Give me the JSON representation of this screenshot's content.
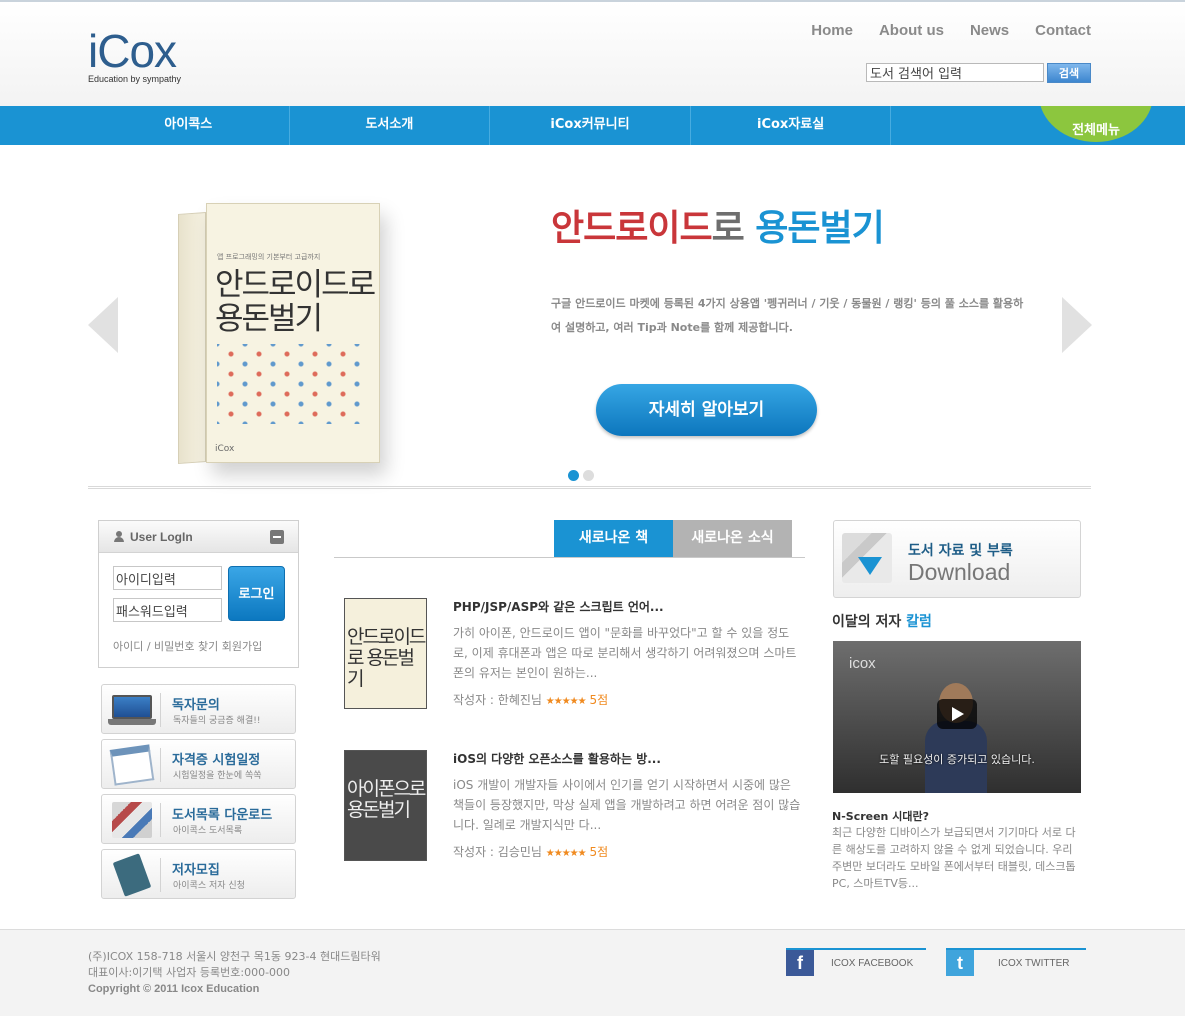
{
  "logo": {
    "text": "iCox",
    "tagline": "Education by sympathy"
  },
  "topnav": [
    "Home",
    "About us",
    "News",
    "Contact"
  ],
  "search": {
    "value": "도서 검색어 입력",
    "button": "검색"
  },
  "gnb": [
    "아이콕스",
    "도서소개",
    "iCox커뮤니티",
    "iCox자료실"
  ],
  "gnb_all": "전체메뉴",
  "hero": {
    "book_title": "안드로이드로 용돈벌기",
    "book_sub": "앱 프로그래밍의 기본부터 고급까지",
    "book_pub": "iCox",
    "title_red": "안드로이드",
    "title_gray": "로 ",
    "title_blue": "용돈벌기",
    "desc": "구글 안드로이드 마켓에 등록된 4가지 상용앱 '펭귀러너 / 기웃 / 동물원 / 랭킹' 등의 풀 소스를 활용하여 설명하고, 여러 Tip과 Note를 함께 제공합니다.",
    "button": "자세히 알아보기",
    "slides": 2,
    "active_slide": 1
  },
  "login": {
    "title": "User LogIn",
    "id_value": "아이디입력",
    "pw_value": "패스워드입력",
    "button": "로그인",
    "links": "아이디 / 비밀번호 찾기  회원가입"
  },
  "quick": [
    {
      "title": "독자문의",
      "sub": "독자들의 궁금증 해결!!"
    },
    {
      "title": "자격증 시험일정",
      "sub": "시험일정을 한눈에 쏙쏙"
    },
    {
      "title": "도서목록 다운로드",
      "sub": "아이콕스 도서목록"
    },
    {
      "title": "저자모집",
      "sub": "아이콕스 저자 신청"
    }
  ],
  "tabs": {
    "active": "새로나온 책",
    "inactive": "새로나온 소식"
  },
  "articles": [
    {
      "cover": "안드로이드로 용돈벌기",
      "title": "PHP/JSP/ASP와 같은 스크립트 언어...",
      "desc": "가히 아이폰, 안드로이드 앱이 \"문화를 바꾸었다\"고 할 수 있을 정도로, 이제 휴대폰과 앱은 따로 분리해서 생각하기 어려워졌으며 스마트폰의 유저는 본인이 원하는...",
      "author": "작성자 : 한혜진님",
      "stars": "★★★★★",
      "score": "5점"
    },
    {
      "cover": "아이폰으로 용돈벌기",
      "title": "iOS의 다양한 오픈소스를 활용하는 방...",
      "desc": "iOS 개발이 개발자들 사이에서 인기를 얻기 시작하면서 시중에 많은 책들이 등장했지만, 막상 실제 앱을 개발하려고 하면 어려운 점이 많습니다. 일례로 개발지식만 다...",
      "author": "작성자 : 김승민님",
      "stars": "★★★★★",
      "score": "5점"
    }
  ],
  "download": {
    "title": "도서 자료 및 부록",
    "sub": "Download"
  },
  "author": {
    "title": "이달의 저자 ",
    "highlight": "칼럼"
  },
  "video": {
    "logo": "icox",
    "subtitle": "도할 필요성이 증가되고 있습니다."
  },
  "column": {
    "title": "N-Screen 시대란?",
    "desc": "최근 다양한 디바이스가 보급되면서 기기마다 서로 다른 해상도를 고려하지 않을 수 없게 되었습니다. 우리 주변만 보더라도 모바일 폰에서부터 태블릿, 데스크톱PC, 스마트TV등..."
  },
  "footer": {
    "address": "(주)ICOX 158-718 서울시 양천구 목1동 923-4 현대드림타워",
    "ceo": "대표이사:이기택 사업자 등록번호:000-000",
    "copyright": "Copyright © 2011 Icox Education",
    "facebook": "ICOX FACEBOOK",
    "twitter": "ICOX TWITTER"
  },
  "colors": {
    "primary": "#1a93d3",
    "green": "#8cc63e",
    "red": "#c9363a"
  }
}
